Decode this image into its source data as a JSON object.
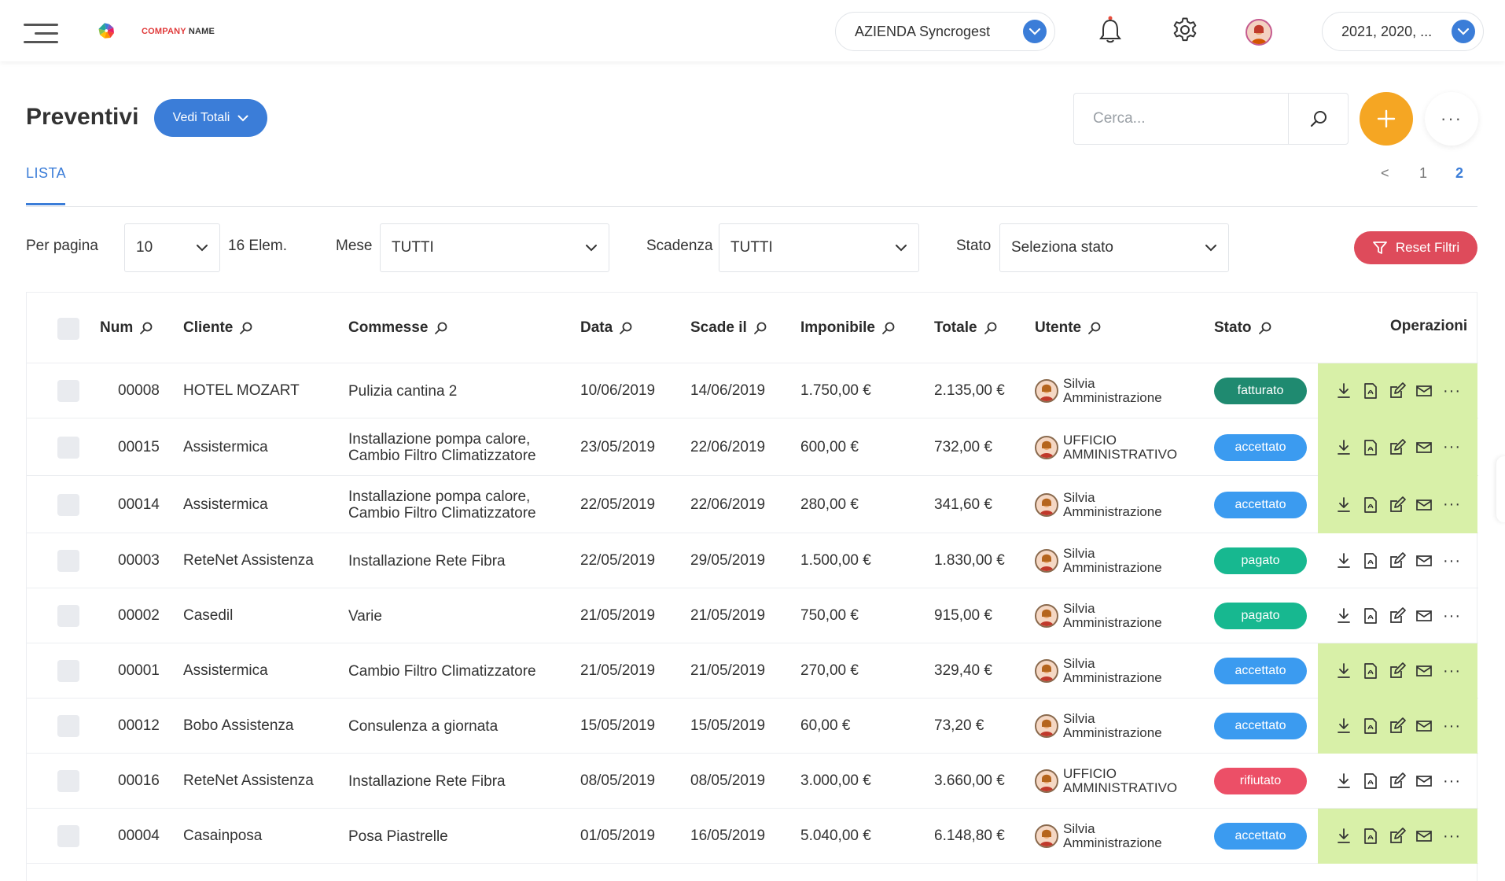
{
  "header": {
    "logo_text_a": "COMPANY",
    "logo_text_b": " NAME",
    "company_select": "AZIENDA Syncrogest",
    "year_select": "2021, 2020, ..."
  },
  "page": {
    "title": "Preventivi",
    "totals_button": "Vedi Totali",
    "search_placeholder": "Cerca...",
    "tab": "LISTA",
    "pager": {
      "prev": "<",
      "pages": [
        "1",
        "2"
      ],
      "current": "2"
    }
  },
  "filters": {
    "per_page_label": "Per pagina",
    "per_page_value": "10",
    "count": "16 Elem.",
    "month_label": "Mese",
    "month_value": "TUTTI",
    "due_label": "Scadenza",
    "due_value": "TUTTI",
    "state_label": "Stato",
    "state_value": "Seleziona stato",
    "reset_label": "Reset Filtri"
  },
  "table": {
    "columns": [
      "Num",
      "Cliente",
      "Commesse",
      "Data",
      "Scade il",
      "Imponibile",
      "Totale",
      "Utente",
      "Stato",
      "Operazioni"
    ],
    "status_colors": {
      "fatturato": "#1f8a70",
      "accettato": "#3b9bf0",
      "pagato": "#17b890",
      "rifiutato": "#ec4f67"
    },
    "ops_highlight_color": "#d8f0a8",
    "rows": [
      {
        "num": "00008",
        "cliente": "HOTEL MOZART",
        "commesse": [
          "Pulizia cantina 2"
        ],
        "data": "10/06/2019",
        "scade": "14/06/2019",
        "imponibile": "1.750,00 €",
        "totale": "2.135,00 €",
        "utente": [
          "Silvia",
          "Amministrazione"
        ],
        "stato": "fatturato",
        "highlight": true
      },
      {
        "num": "00015",
        "cliente": "Assistermica",
        "commesse": [
          "Installazione pompa calore,",
          "Cambio Filtro Climatizzatore"
        ],
        "data": "23/05/2019",
        "scade": "22/06/2019",
        "imponibile": "600,00 €",
        "totale": "732,00 €",
        "utente": [
          "UFFICIO",
          "AMMINISTRATIVO"
        ],
        "stato": "accettato",
        "highlight": true
      },
      {
        "num": "00014",
        "cliente": "Assistermica",
        "commesse": [
          "Installazione pompa calore,",
          "Cambio Filtro Climatizzatore"
        ],
        "data": "22/05/2019",
        "scade": "22/06/2019",
        "imponibile": "280,00 €",
        "totale": "341,60 €",
        "utente": [
          "Silvia",
          "Amministrazione"
        ],
        "stato": "accettato",
        "highlight": true
      },
      {
        "num": "00003",
        "cliente": "ReteNet Assistenza",
        "commesse": [
          "Installazione Rete Fibra"
        ],
        "data": "22/05/2019",
        "scade": "29/05/2019",
        "imponibile": "1.500,00 €",
        "totale": "1.830,00 €",
        "utente": [
          "Silvia",
          "Amministrazione"
        ],
        "stato": "pagato",
        "highlight": false
      },
      {
        "num": "00002",
        "cliente": "Casedil",
        "commesse": [
          "Varie"
        ],
        "data": "21/05/2019",
        "scade": "21/05/2019",
        "imponibile": "750,00 €",
        "totale": "915,00 €",
        "utente": [
          "Silvia",
          "Amministrazione"
        ],
        "stato": "pagato",
        "highlight": false
      },
      {
        "num": "00001",
        "cliente": "Assistermica",
        "commesse": [
          "Cambio Filtro Climatizzatore"
        ],
        "data": "21/05/2019",
        "scade": "21/05/2019",
        "imponibile": "270,00 €",
        "totale": "329,40 €",
        "utente": [
          "Silvia",
          "Amministrazione"
        ],
        "stato": "accettato",
        "highlight": true
      },
      {
        "num": "00012",
        "cliente": "Bobo Assistenza",
        "commesse": [
          "Consulenza a giornata"
        ],
        "data": "15/05/2019",
        "scade": "15/05/2019",
        "imponibile": "60,00 €",
        "totale": "73,20 €",
        "utente": [
          "Silvia",
          "Amministrazione"
        ],
        "stato": "accettato",
        "highlight": true
      },
      {
        "num": "00016",
        "cliente": "ReteNet Assistenza",
        "commesse": [
          "Installazione Rete Fibra"
        ],
        "data": "08/05/2019",
        "scade": "08/05/2019",
        "imponibile": "3.000,00 €",
        "totale": "3.660,00 €",
        "utente": [
          "UFFICIO",
          "AMMINISTRATIVO"
        ],
        "stato": "rifiutato",
        "highlight": false
      },
      {
        "num": "00004",
        "cliente": "Casainposa",
        "commesse": [
          "Posa Piastrelle"
        ],
        "data": "01/05/2019",
        "scade": "16/05/2019",
        "imponibile": "5.040,00 €",
        "totale": "6.148,80 €",
        "utente": [
          "Silvia",
          "Amministrazione"
        ],
        "stato": "accettato",
        "highlight": true
      }
    ]
  }
}
